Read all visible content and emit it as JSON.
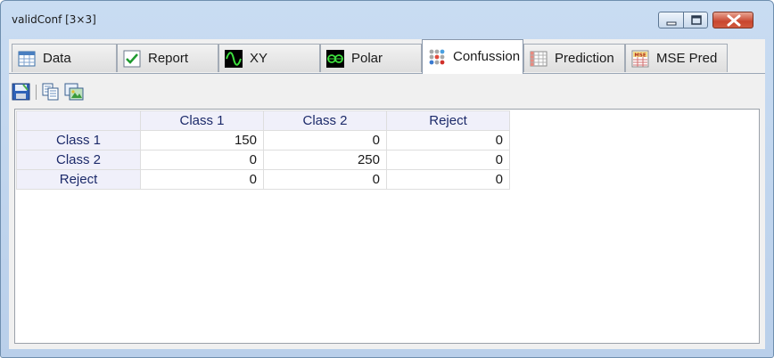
{
  "window": {
    "title": "validConf [3×3]"
  },
  "tabs": [
    {
      "label": "Data",
      "icon": "table-icon"
    },
    {
      "label": "Report",
      "icon": "checkmark-icon"
    },
    {
      "label": "XY",
      "icon": "xy-wave-icon"
    },
    {
      "label": "Polar",
      "icon": "polar-icon"
    },
    {
      "label": "Confussion",
      "icon": "dots-grid-icon"
    },
    {
      "label": "Prediction",
      "icon": "prediction-grid-icon"
    },
    {
      "label": "MSE Pred",
      "icon": "mse-icon"
    }
  ],
  "active_tab": "Confussion",
  "table": {
    "columns": [
      "Class 1",
      "Class 2",
      "Reject"
    ],
    "rows": [
      {
        "label": "Class 1",
        "values": [
          "150",
          "0",
          "0"
        ]
      },
      {
        "label": "Class 2",
        "values": [
          "0",
          "250",
          "0"
        ]
      },
      {
        "label": "Reject",
        "values": [
          "0",
          "0",
          "0"
        ]
      }
    ]
  }
}
